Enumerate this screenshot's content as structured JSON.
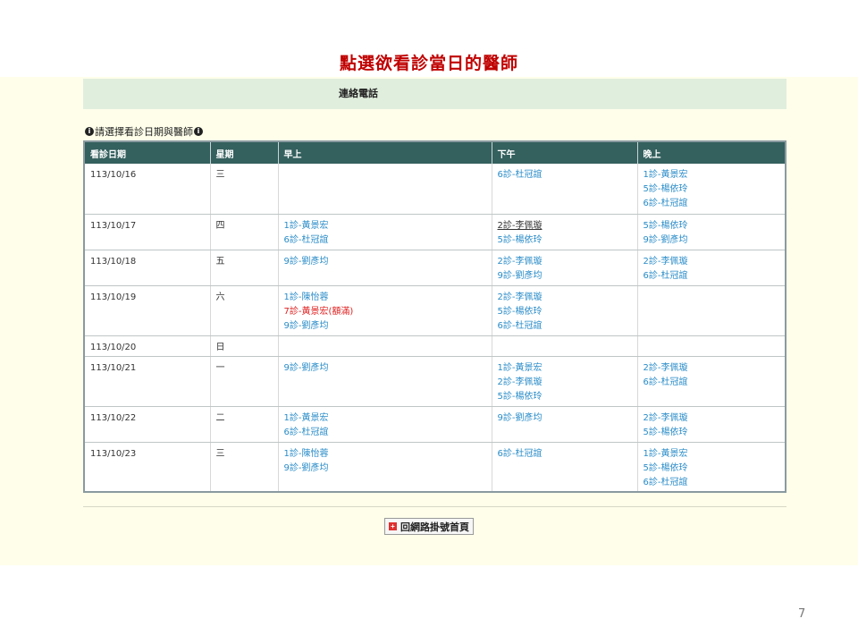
{
  "slide_title": "點選欲看診當日的醫師",
  "contact_label": "連絡電話",
  "instruction": "請選擇看診日期與醫師",
  "icons": {
    "info": "info-icon",
    "home": "hospital-cross-icon"
  },
  "table": {
    "headers": [
      "看診日期",
      "星期",
      "早上",
      "下午",
      "晚上"
    ],
    "rows": [
      {
        "date": "113/10/16",
        "weekday": "三",
        "morning": [],
        "afternoon": [
          {
            "text": "6診-杜冠誼"
          }
        ],
        "evening": [
          {
            "text": "1診-黃景宏"
          },
          {
            "text": "5診-楊依玲"
          },
          {
            "text": "6診-杜冠誼"
          }
        ]
      },
      {
        "date": "113/10/17",
        "weekday": "四",
        "morning": [
          {
            "text": "1診-黃景宏"
          },
          {
            "text": "6診-杜冠誼"
          }
        ],
        "afternoon": [
          {
            "text": "2診-李佩璇",
            "status": "hover"
          },
          {
            "text": "5診-楊依玲"
          }
        ],
        "evening": [
          {
            "text": "5診-楊依玲"
          },
          {
            "text": "9診-劉彥均"
          }
        ]
      },
      {
        "date": "113/10/18",
        "weekday": "五",
        "morning": [
          {
            "text": "9診-劉彥均"
          }
        ],
        "afternoon": [
          {
            "text": "2診-李佩璇"
          },
          {
            "text": "9診-劉彥均"
          }
        ],
        "evening": [
          {
            "text": "2診-李佩璇"
          },
          {
            "text": "6診-杜冠誼"
          }
        ]
      },
      {
        "date": "113/10/19",
        "weekday": "六",
        "morning": [
          {
            "text": "1診-陳怡蓉"
          },
          {
            "text": "7診-黃景宏(額滿)",
            "status": "full"
          },
          {
            "text": "9診-劉彥均"
          }
        ],
        "afternoon": [
          {
            "text": "2診-李佩璇"
          },
          {
            "text": "5診-楊依玲"
          },
          {
            "text": "6診-杜冠誼"
          }
        ],
        "evening": []
      },
      {
        "date": "113/10/20",
        "weekday": "日",
        "morning": [],
        "afternoon": [],
        "evening": []
      },
      {
        "date": "113/10/21",
        "weekday": "一",
        "morning": [
          {
            "text": "9診-劉彥均"
          }
        ],
        "afternoon": [
          {
            "text": "1診-黃景宏"
          },
          {
            "text": "2診-李佩璇"
          },
          {
            "text": "5診-楊依玲"
          }
        ],
        "evening": [
          {
            "text": "2診-李佩璇"
          },
          {
            "text": "6診-杜冠誼"
          }
        ]
      },
      {
        "date": "113/10/22",
        "weekday": "二",
        "morning": [
          {
            "text": "1診-黃景宏"
          },
          {
            "text": "6診-杜冠誼"
          }
        ],
        "afternoon": [
          {
            "text": "9診-劉彥均"
          }
        ],
        "evening": [
          {
            "text": "2診-李佩璇"
          },
          {
            "text": "5診-楊依玲"
          }
        ]
      },
      {
        "date": "113/10/23",
        "weekday": "三",
        "morning": [
          {
            "text": "1診-陳怡蓉"
          },
          {
            "text": "9診-劉彥均"
          }
        ],
        "afternoon": [
          {
            "text": "6診-杜冠誼"
          }
        ],
        "evening": [
          {
            "text": "1診-黃景宏"
          },
          {
            "text": "5診-楊依玲"
          },
          {
            "text": "6診-杜冠誼"
          }
        ]
      }
    ]
  },
  "home_button_label": "回網路掛號首頁",
  "page_number": "7",
  "colors": {
    "title": "#c00000",
    "header_bg": "#34605e",
    "link": "#2a8cc8",
    "full": "#e02020",
    "panel_bg": "#fefeea"
  }
}
